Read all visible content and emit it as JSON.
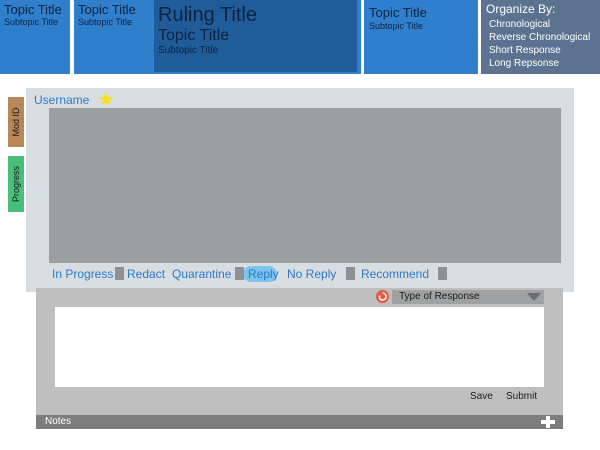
{
  "topnav": {
    "tiles": [
      {
        "title": "Topic Title",
        "subtitle": "Subtopic Title"
      },
      {
        "title": "Topic Title",
        "subtitle": "Subtopic Title"
      },
      {
        "title": "Topic Title",
        "subtitle": "Subtopic Title"
      }
    ],
    "ruling": {
      "title": "Ruling Title",
      "topic": "Topic Title",
      "subtopic": "Subtopic Title"
    },
    "organize": {
      "heading": "Organize By:",
      "options": [
        "Chronological",
        "Reverse Chronological",
        "Short Response",
        "Long Repsonse"
      ]
    }
  },
  "sidetabs": {
    "mod_id": "Mod ID",
    "progress": "Progress"
  },
  "card": {
    "username": "Username",
    "actions": [
      "In Progress",
      "Redact",
      "Quarantine",
      "Reply",
      "No Reply",
      "Recommend"
    ],
    "selected_action": "Reply"
  },
  "response": {
    "type_placeholder": "Type of Response",
    "save": "Save",
    "submit": "Submit"
  },
  "notes": {
    "label": "Notes"
  },
  "icons": [
    "star-icon",
    "response-type-icon",
    "dropdown-arrow-icon",
    "plus-icon"
  ],
  "colors": {
    "nav_blue": "#2f7fcd",
    "ruling_blue": "#1f5c99",
    "organize_slate": "#5b7390",
    "mod_id_tab": "#b98658",
    "progress_tab": "#45bf7a",
    "link_blue": "#2b7bc9",
    "star_yellow": "#f5e21b",
    "highlight": "#7cc3ef"
  }
}
